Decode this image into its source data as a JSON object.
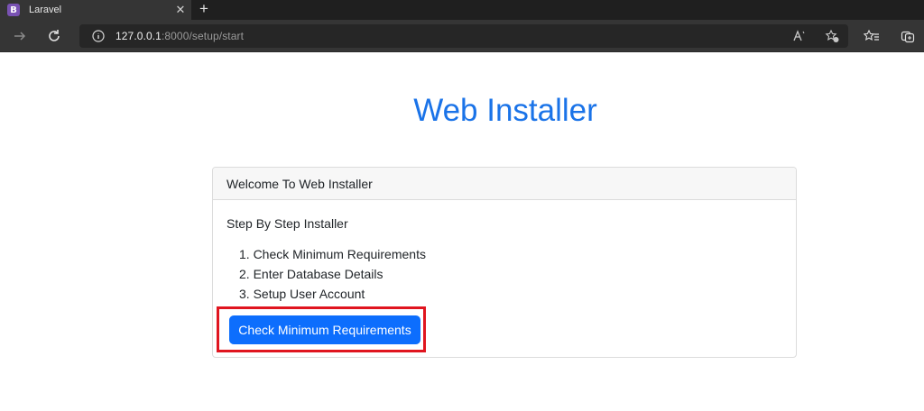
{
  "browser": {
    "tab": {
      "favicon_letter": "B",
      "title": "Laravel",
      "close": "✕"
    },
    "new_tab": "+",
    "address": {
      "host": "127.0.0.1",
      "rest": ":8000/setup/start"
    },
    "colors": {
      "accent": "#0d6efd",
      "title": "#1a73e8",
      "highlight": "#e0151f"
    }
  },
  "page": {
    "title": "Web Installer",
    "card": {
      "header": "Welcome To Web Installer",
      "intro": "Step By Step Installer",
      "steps": [
        "1. Check Minimum Requirements",
        "2. Enter Database Details",
        "3. Setup User Account"
      ],
      "button_label": "Check Minimum Requirements"
    }
  }
}
